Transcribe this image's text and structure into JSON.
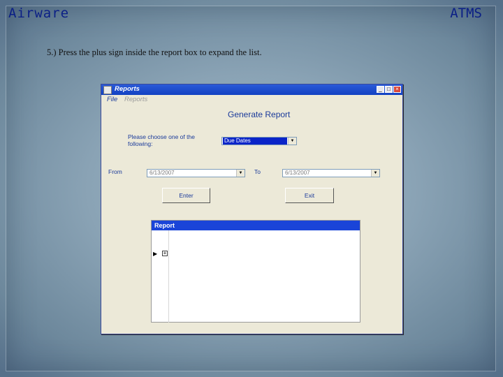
{
  "slide": {
    "header_left": "Airware",
    "header_right": "ATMS",
    "instruction": "5.) Press the plus sign inside the report box to expand the list."
  },
  "window": {
    "title": "Reports",
    "controls": {
      "minimize": "_",
      "maximize": "□",
      "close": "×"
    },
    "menu": {
      "file": "File",
      "reports": "Reports"
    },
    "form_title": "Generate Report",
    "choose_label": "Please choose one of the following:",
    "report_type": {
      "value": "Due Dates"
    },
    "from_label": "From",
    "from_date": "6/13/2007",
    "to_label": "To",
    "to_date": "6/13/2007",
    "enter_button": "Enter",
    "exit_button": "Exit",
    "report": {
      "header": "Report",
      "row_arrow": "▶",
      "expand": "+"
    }
  },
  "colors": {
    "titlebar": "#1241c2",
    "label_text": "#1a3a9a",
    "slide_header": "#0b1f86"
  }
}
